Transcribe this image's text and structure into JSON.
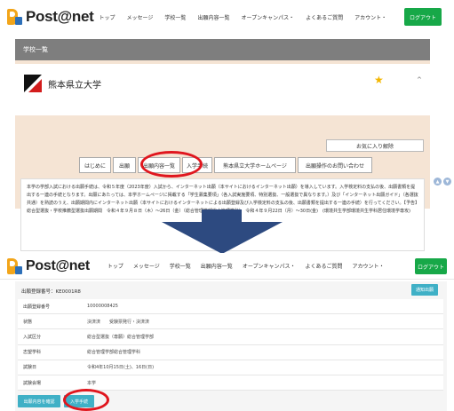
{
  "header": {
    "logo": "Post@net",
    "nav": [
      "トップ",
      "メッセージ",
      "学校一覧",
      "出願内容一覧",
      "オープンキャンパス・",
      "よくあるご質問",
      "アカウント・"
    ],
    "logout": "ログアウト"
  },
  "screen1": {
    "list_title": "学校一覧",
    "university": "熊本県立大学",
    "favorite_button": "お気に入り解除",
    "tabs": [
      "はじめに",
      "出願",
      "出願内容一覧",
      "入学手続",
      "熊本県立大学ホームページ",
      "出願操作のお問い合わせ"
    ],
    "info_text": "本学の学部入試における出願手続は、令和５年度（2023年度）入試から、インターネット出願（本サイトにおけるインターネット出願）を導入しています。入学検定料の支払の後、出願書類を提出する一連の手続となります。出願にあたっては、本学ホームページに掲載する「学生募集要項」（各入試実施要項、特別選抜、一般選抜で異なります。）及び「インターネット出願ガイド」（各選抜共通）を熟読のうえ、出願期間内にインターネット出願（本サイトにおけるインターネットによる出願登録及び入学検定料の支払の後、出願書類を提出する一連の手続）を行ってください。【予告】総合型選抜・学校推薦型選抜出願期間　令和４年９月８日（木）～26日（金）（総合管理学部総合管理学科）　令和４年９月22日（月）～30日(金)　(環境共生学部環境共生学科居住環境学専攻)"
  },
  "screen2": {
    "app_number_label": "出願登録番号：",
    "app_number_value": "KE0001R8",
    "contact_button": "通知出願",
    "rows": [
      {
        "label": "出願登録番号",
        "value": "10000008425"
      },
      {
        "label": "状態",
        "value": "決済済　　受験票発行・決済済"
      },
      {
        "label": "入試区分",
        "value": "総合型選抜（専願）総合管理学部"
      },
      {
        "label": "志望学科",
        "value": "総合管理学部総合管理学科"
      },
      {
        "label": "試験日",
        "value": "令和4年10月15日(土)、16日(日)"
      },
      {
        "label": "試験会場",
        "value": "本学"
      }
    ],
    "buttons": [
      "出願内容を確認",
      "入学手続"
    ]
  },
  "colors": {
    "logout_green": "#17a848",
    "teal_button": "#3fb0c6",
    "highlight_red": "#e0161e",
    "arrow_navy": "#2d4a80",
    "star_gold": "#f3b600"
  }
}
